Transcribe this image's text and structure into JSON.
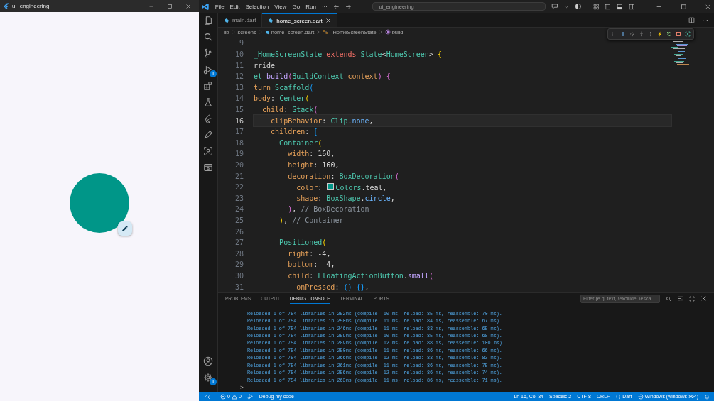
{
  "flutter_window": {
    "title": "ui_engineering"
  },
  "menu": [
    "File",
    "Edit",
    "Selection",
    "View",
    "Go",
    "Run",
    "···"
  ],
  "command_center": {
    "value": "ui_engineering"
  },
  "activity_bar": [
    {
      "kind": "files"
    },
    {
      "kind": "search"
    },
    {
      "kind": "branch"
    },
    {
      "kind": "debug",
      "badge": "1"
    },
    {
      "kind": "extensions"
    },
    {
      "kind": "flask"
    },
    {
      "kind": "flutter"
    },
    {
      "kind": "pen"
    },
    {
      "kind": "remote"
    },
    {
      "kind": "preview"
    }
  ],
  "account_items": [
    {
      "kind": "account"
    },
    {
      "kind": "settings",
      "badge": "1"
    }
  ],
  "tabs": [
    {
      "label": "main.dart",
      "selected": false
    },
    {
      "label": "home_screen.dart",
      "selected": true
    }
  ],
  "breadcrumbs": [
    {
      "text": "lib",
      "kind": "folder"
    },
    {
      "text": "screens",
      "kind": "folder"
    },
    {
      "text": "home_screen.dart",
      "kind": "dart"
    },
    {
      "text": "_HomeScreenState",
      "kind": "class"
    },
    {
      "text": "build",
      "kind": "method"
    }
  ],
  "editor": {
    "lines": [
      {
        "number": "9",
        "current": false
      },
      {
        "number": "10",
        "current": false,
        "tokens": [
          {
            "text": "_HomeScreenState ",
            "kind": "type"
          },
          {
            "text": "extends",
            "kind": "kw"
          },
          {
            "text": " State",
            "kind": "type"
          },
          {
            "text": "<",
            "kind": "plain"
          },
          {
            "text": "HomeScreen",
            "kind": "type"
          },
          {
            "text": "> ",
            "kind": "plain"
          },
          {
            "text": "{",
            "kind": "b1"
          }
        ]
      },
      {
        "number": "11",
        "current": false,
        "tokens": [
          {
            "text": "rride",
            "kind": "plain"
          }
        ]
      },
      {
        "number": "12",
        "current": false,
        "tokens": [
          {
            "text": "et ",
            "kind": "type"
          },
          {
            "text": "build",
            "kind": "fn"
          },
          {
            "text": "(",
            "kind": "b2"
          },
          {
            "text": "BuildContext ",
            "kind": "type"
          },
          {
            "text": "context",
            "kind": "prop"
          },
          {
            "text": ") {",
            "kind": "b2"
          }
        ]
      },
      {
        "number": "13",
        "current": false,
        "tokens": [
          {
            "text": "turn ",
            "kind": "prop"
          },
          {
            "text": "Scaffold",
            "kind": "type"
          },
          {
            "text": "(",
            "kind": "b3"
          }
        ]
      },
      {
        "number": "14",
        "current": false,
        "tokens": [
          {
            "text": "body",
            "kind": "prop"
          },
          {
            "text": ": ",
            "kind": "plain"
          },
          {
            "text": "Center",
            "kind": "type"
          },
          {
            "text": "(",
            "kind": "b1"
          }
        ]
      },
      {
        "number": "15",
        "current": false,
        "tokens": [
          {
            "text": "  child",
            "kind": "prop"
          },
          {
            "text": ": ",
            "kind": "plain"
          },
          {
            "text": "Stack",
            "kind": "type"
          },
          {
            "text": "(",
            "kind": "b2"
          }
        ]
      },
      {
        "number": "16",
        "current": true,
        "tokens": [
          {
            "text": "    clipBehavior",
            "kind": "prop"
          },
          {
            "text": ": ",
            "kind": "plain"
          },
          {
            "text": "Clip",
            "kind": "type"
          },
          {
            "text": ".",
            "kind": "plain"
          },
          {
            "text": "none",
            "kind": "enum"
          },
          {
            "text": ",",
            "kind": "plain"
          }
        ]
      },
      {
        "number": "17",
        "current": false,
        "tokens": [
          {
            "text": "    children",
            "kind": "prop"
          },
          {
            "text": ": ",
            "kind": "plain"
          },
          {
            "text": "[",
            "kind": "b3"
          }
        ]
      },
      {
        "number": "18",
        "current": false,
        "tokens": [
          {
            "text": "      Container",
            "kind": "type"
          },
          {
            "text": "(",
            "kind": "b1"
          }
        ]
      },
      {
        "number": "19",
        "current": false,
        "tokens": [
          {
            "text": "        width",
            "kind": "prop"
          },
          {
            "text": ": ",
            "kind": "plain"
          },
          {
            "text": "160",
            "kind": "num"
          },
          {
            "text": ",",
            "kind": "plain"
          }
        ]
      },
      {
        "number": "20",
        "current": false,
        "tokens": [
          {
            "text": "        height",
            "kind": "prop"
          },
          {
            "text": ": ",
            "kind": "plain"
          },
          {
            "text": "160",
            "kind": "num"
          },
          {
            "text": ",",
            "kind": "plain"
          }
        ]
      },
      {
        "number": "21",
        "current": false,
        "tokens": [
          {
            "text": "        decoration",
            "kind": "prop"
          },
          {
            "text": ": ",
            "kind": "plain"
          },
          {
            "text": "BoxDecoration",
            "kind": "type"
          },
          {
            "text": "(",
            "kind": "b2"
          }
        ]
      },
      {
        "number": "22",
        "current": false,
        "tokens": [
          {
            "text": "          color",
            "kind": "prop"
          },
          {
            "text": ": ",
            "kind": "plain"
          },
          {
            "kind": "swatch",
            "color": "#009688"
          },
          {
            "text": "Colors",
            "kind": "type"
          },
          {
            "text": ".teal,",
            "kind": "plain"
          }
        ]
      },
      {
        "number": "23",
        "current": false,
        "tokens": [
          {
            "text": "          shape",
            "kind": "prop"
          },
          {
            "text": ": ",
            "kind": "plain"
          },
          {
            "text": "BoxShape",
            "kind": "type"
          },
          {
            "text": ".",
            "kind": "plain"
          },
          {
            "text": "circle",
            "kind": "enum"
          },
          {
            "text": ",",
            "kind": "plain"
          }
        ]
      },
      {
        "number": "24",
        "current": false,
        "tokens": [
          {
            "text": "        )",
            "kind": "b2"
          },
          {
            "text": ", ",
            "kind": "plain"
          },
          {
            "text": "// BoxDecoration",
            "kind": "comment"
          }
        ]
      },
      {
        "number": "25",
        "current": false,
        "tokens": [
          {
            "text": "      )",
            "kind": "b1"
          },
          {
            "text": ", ",
            "kind": "plain"
          },
          {
            "text": "// Container",
            "kind": "comment"
          }
        ]
      },
      {
        "number": "26",
        "current": false
      },
      {
        "number": "27",
        "current": false,
        "tokens": [
          {
            "text": "      Positioned",
            "kind": "type"
          },
          {
            "text": "(",
            "kind": "b1"
          }
        ]
      },
      {
        "number": "28",
        "current": false,
        "tokens": [
          {
            "text": "        right",
            "kind": "prop"
          },
          {
            "text": ": ",
            "kind": "plain"
          },
          {
            "text": "-4",
            "kind": "num"
          },
          {
            "text": ",",
            "kind": "plain"
          }
        ]
      },
      {
        "number": "29",
        "current": false,
        "tokens": [
          {
            "text": "        bottom",
            "kind": "prop"
          },
          {
            "text": ": ",
            "kind": "plain"
          },
          {
            "text": "-4",
            "kind": "num"
          },
          {
            "text": ",",
            "kind": "plain"
          }
        ]
      },
      {
        "number": "30",
        "current": false,
        "tokens": [
          {
            "text": "        child",
            "kind": "prop"
          },
          {
            "text": ": ",
            "kind": "plain"
          },
          {
            "text": "FloatingActionButton",
            "kind": "type"
          },
          {
            "text": ".",
            "kind": "plain"
          },
          {
            "text": "small",
            "kind": "fn"
          },
          {
            "text": "(",
            "kind": "b2"
          }
        ]
      },
      {
        "number": "31",
        "current": false,
        "tokens": [
          {
            "text": "          onPressed",
            "kind": "prop"
          },
          {
            "text": ": ",
            "kind": "plain"
          },
          {
            "text": "() {}",
            "kind": "b3"
          },
          {
            "text": ",",
            "kind": "plain"
          }
        ]
      }
    ]
  },
  "panel": {
    "tabs": [
      {
        "label": "PROBLEMS",
        "selected": false
      },
      {
        "label": "OUTPUT",
        "selected": false
      },
      {
        "label": "DEBUG CONSOLE",
        "selected": true
      },
      {
        "label": "TERMINAL",
        "selected": false
      },
      {
        "label": "PORTS",
        "selected": false
      }
    ],
    "filter": {
      "placeholder": "Filter (e.g. text, !exclude, \\esca..."
    },
    "output": [
      "Reloaded 1 of 754 libraries in 252ms (compile: 10 ms, reload: 85 ms, reassemble: 70 ms).",
      "Reloaded 1 of 754 libraries in 250ms (compile: 11 ms, reload: 84 ms, reassemble: 67 ms).",
      "Reloaded 1 of 754 libraries in 246ms (compile: 11 ms, reload: 83 ms, reassemble: 65 ms).",
      "Reloaded 1 of 754 libraries in 259ms (compile: 10 ms, reload: 85 ms, reassemble: 68 ms).",
      "Reloaded 1 of 754 libraries in 289ms (compile: 12 ms, reload: 88 ms, reassemble: 100 ms).",
      "Reloaded 1 of 754 libraries in 250ms (compile: 11 ms, reload: 86 ms, reassemble: 66 ms).",
      "Reloaded 1 of 754 libraries in 266ms (compile: 12 ms, reload: 83 ms, reassemble: 83 ms).",
      "Reloaded 1 of 754 libraries in 261ms (compile: 11 ms, reload: 86 ms, reassemble: 75 ms).",
      "Reloaded 1 of 754 libraries in 256ms (compile: 12 ms, reload: 86 ms, reassemble: 74 ms).",
      "Reloaded 1 of 754 libraries in 263ms (compile: 11 ms, reload: 86 ms, reassemble: 71 ms)."
    ],
    "prompt": ">"
  },
  "status_bar": {
    "errors": "0",
    "warnings": "0",
    "debug": "Debug my code",
    "items": [
      {
        "text": "Ln 16, Col 34",
        "kind": "plain"
      },
      {
        "text": "Spaces: 2",
        "kind": "plain"
      },
      {
        "text": "UTF-8",
        "kind": "plain"
      },
      {
        "text": "CRLF",
        "kind": "plain"
      },
      {
        "text": "Dart",
        "kind": "braces"
      },
      {
        "text": "Windows (windows-x64)",
        "kind": "device"
      }
    ]
  }
}
